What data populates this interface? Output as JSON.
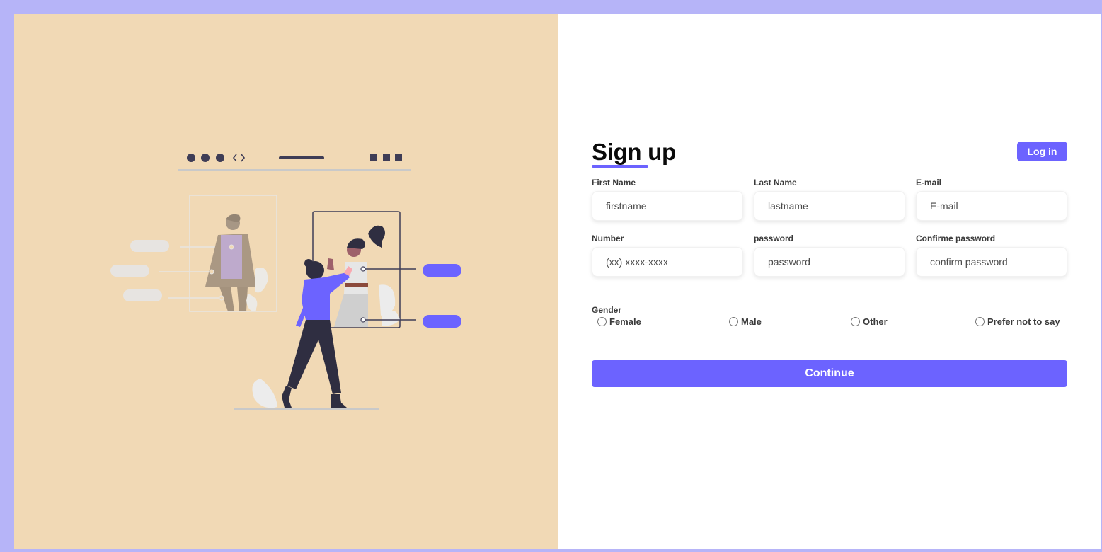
{
  "colors": {
    "accent": "#6c63ff",
    "illustration_bg": "#f1d9b5",
    "page_bg": "#b6b4f8"
  },
  "illustration": {
    "name": "person-interacting-with-profile-cards-illustration"
  },
  "signup": {
    "title": "Sign up",
    "login_label": "Log in",
    "fields": [
      {
        "label": "First Name",
        "placeholder": "firstname",
        "value": ""
      },
      {
        "label": "Last Name",
        "placeholder": "lastname",
        "value": ""
      },
      {
        "label": "E-mail",
        "placeholder": "E-mail",
        "value": ""
      },
      {
        "label": "Number",
        "placeholder": "(xx) xxxx-xxxx",
        "value": ""
      },
      {
        "label": "password",
        "placeholder": "password",
        "value": ""
      },
      {
        "label": "Confirme password",
        "placeholder": "confirm password",
        "value": ""
      }
    ],
    "gender": {
      "label": "Gender",
      "options": [
        "Female",
        "Male",
        "Other",
        "Prefer not to say"
      ],
      "selected": null
    },
    "continue_label": "Continue"
  }
}
